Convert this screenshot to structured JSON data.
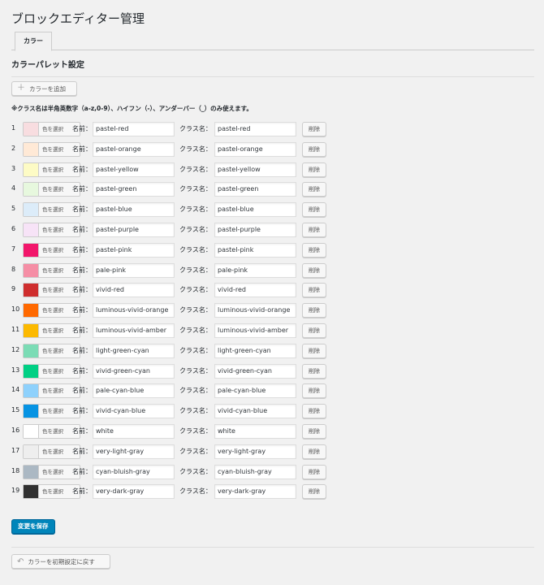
{
  "page_title": "ブロックエディター管理",
  "tab": "カラー",
  "section_title": "カラーパレット設定",
  "add_button": "カラーを追加",
  "note": "※クラス名は半角英数字（a-z,0-9）、ハイフン（-）、アンダーバー（_）のみ使えます。",
  "labels": {
    "name": "名前：",
    "class": "クラス名：",
    "pick": "色を選択",
    "delete": "削除"
  },
  "colors": [
    {
      "num": "1",
      "swatch": "#f8dde0",
      "name": "pastel-red",
      "class": "pastel-red"
    },
    {
      "num": "2",
      "swatch": "#ffe9d6",
      "name": "pastel-orange",
      "class": "pastel-orange"
    },
    {
      "num": "3",
      "swatch": "#fdfbc5",
      "name": "pastel-yellow",
      "class": "pastel-yellow"
    },
    {
      "num": "4",
      "swatch": "#e7f8de",
      "name": "pastel-green",
      "class": "pastel-green"
    },
    {
      "num": "5",
      "swatch": "#dcecf9",
      "name": "pastel-blue",
      "class": "pastel-blue"
    },
    {
      "num": "6",
      "swatch": "#f7e3f7",
      "name": "pastel-purple",
      "class": "pastel-purple"
    },
    {
      "num": "7",
      "swatch": "#f2166b",
      "name": "pastel-pink",
      "class": "pastel-pink"
    },
    {
      "num": "8",
      "swatch": "#f58ea5",
      "name": "pale-pink",
      "class": "pale-pink"
    },
    {
      "num": "9",
      "swatch": "#cf2e2e",
      "name": "vivid-red",
      "class": "vivid-red"
    },
    {
      "num": "10",
      "swatch": "#ff6900",
      "name": "luminous-vivid-orange",
      "class": "luminous-vivid-orange"
    },
    {
      "num": "11",
      "swatch": "#fcb900",
      "name": "luminous-vivid-amber",
      "class": "luminous-vivid-amber"
    },
    {
      "num": "12",
      "swatch": "#7bdcb5",
      "name": "light-green-cyan",
      "class": "light-green-cyan"
    },
    {
      "num": "13",
      "swatch": "#00d084",
      "name": "vivid-green-cyan",
      "class": "vivid-green-cyan"
    },
    {
      "num": "14",
      "swatch": "#8ed1fc",
      "name": "pale-cyan-blue",
      "class": "pale-cyan-blue"
    },
    {
      "num": "15",
      "swatch": "#0693e3",
      "name": "vivid-cyan-blue",
      "class": "vivid-cyan-blue"
    },
    {
      "num": "16",
      "swatch": "#ffffff",
      "name": "white",
      "class": "white"
    },
    {
      "num": "17",
      "swatch": "#eeeeee",
      "name": "very-light-gray",
      "class": "very-light-gray"
    },
    {
      "num": "18",
      "swatch": "#abb8c3",
      "name": "cyan-bluish-gray",
      "class": "cyan-bluish-gray"
    },
    {
      "num": "19",
      "swatch": "#313131",
      "name": "very-dark-gray",
      "class": "very-dark-gray"
    }
  ],
  "save_button": "変更を保存",
  "reset_button": "カラーを初期設定に戻す",
  "theme": {
    "primary": "#0085ba"
  }
}
